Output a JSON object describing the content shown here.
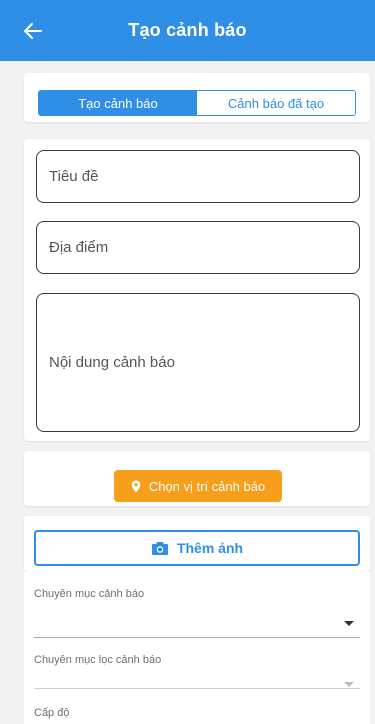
{
  "header": {
    "title": "Tạo cảnh báo",
    "back_icon": "arrow-left-icon"
  },
  "tabs": [
    {
      "label": "Tạo cảnh báo",
      "active": true
    },
    {
      "label": "Cảnh báo đã tạo",
      "active": false
    }
  ],
  "form": {
    "title_placeholder": "Tiêu đề",
    "place_placeholder": "Địa điểm",
    "content_placeholder": "Nội dung cảnh báo"
  },
  "location_button": {
    "label": "Chọn vị trí cảnh báo",
    "icon": "map-pin-icon"
  },
  "photo_button": {
    "label": "Thêm ảnh",
    "icon": "camera-icon"
  },
  "selects": {
    "category_label": "Chuyên mục cảnh báo",
    "filter_category_label": "Chuyên mục lọc cảnh báo",
    "level_label": "Cấp độ"
  },
  "colors": {
    "primary": "#2f8fe6",
    "accent": "#f79e1b"
  }
}
